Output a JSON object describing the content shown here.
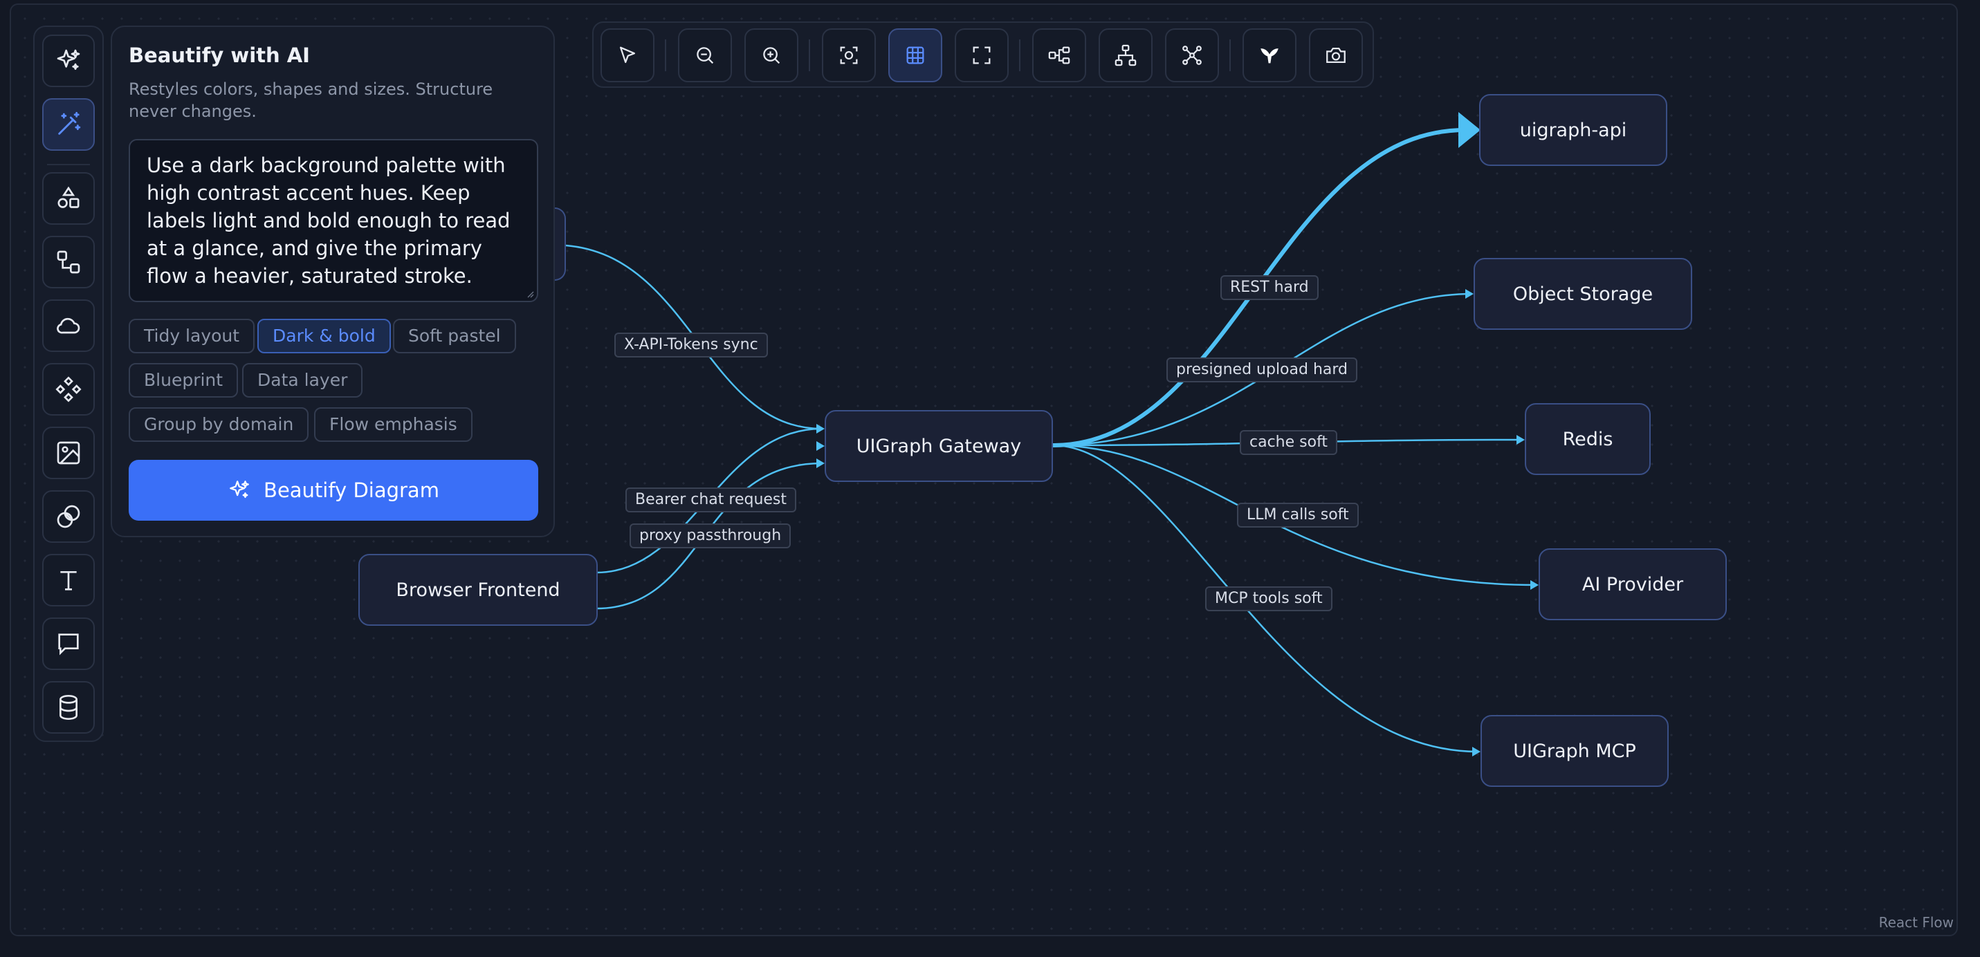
{
  "colors": {
    "background": "#141a27",
    "accent": "#3a6ff7",
    "edge": "#4fc0f4",
    "node_border": "#3a4f86",
    "node_fill": "#1b2135"
  },
  "left_toolbar": {
    "items": [
      {
        "name": "sparkles-icon",
        "active": false
      },
      {
        "name": "magic-wand-icon",
        "active": true
      },
      {
        "name": "shapes-icon",
        "active": false
      },
      {
        "name": "connector-icon",
        "active": false
      },
      {
        "name": "cloud-icon",
        "active": false
      },
      {
        "name": "components-icon",
        "active": false
      },
      {
        "name": "image-icon",
        "active": false
      },
      {
        "name": "layers-icon",
        "active": false
      },
      {
        "name": "text-icon",
        "active": false
      },
      {
        "name": "comment-icon",
        "active": false
      },
      {
        "name": "database-icon",
        "active": false
      }
    ]
  },
  "beautify_panel": {
    "title": "Beautify with AI",
    "subtitle": "Restyles colors, shapes and sizes. Structure never changes.",
    "prompt_value": "Use a dark background palette with high contrast accent hues. Keep labels light and bold enough to read at a glance, and give the primary flow a heavier, saturated stroke.",
    "presets": [
      "Tidy layout",
      "Dark & bold",
      "Soft pastel",
      "Blueprint",
      "Data layer",
      "Group by domain",
      "Flow emphasis"
    ],
    "selected_preset": "Dark & bold",
    "button_label": "Beautify Diagram",
    "button_icon": "sparkles-icon"
  },
  "top_toolbar": {
    "items": [
      "pointer-icon",
      "zoom-out-icon",
      "zoom-in-icon",
      "focus-icon",
      "grid-icon",
      "fit-view-icon",
      "layout-horizontal-icon",
      "layout-tree-icon",
      "layout-force-icon",
      "mermaid-icon",
      "camera-icon"
    ],
    "active": "grid-icon"
  },
  "diagram": {
    "nodes": {
      "gateway": "UIGraph Gateway",
      "browser": "Browser Frontend",
      "api": "uigraph-api",
      "storage": "Object Storage",
      "redis": "Redis",
      "ai": "AI Provider",
      "mcp": "UIGraph MCP"
    },
    "edge_labels": {
      "tokens": "X-API-Tokens sync",
      "bearer": "Bearer chat request",
      "proxy": "proxy passthrough",
      "rest": "REST hard",
      "presigned": "presigned upload hard",
      "cache": "cache soft",
      "llm": "LLM calls soft",
      "mcp_tools": "MCP tools soft"
    }
  },
  "attribution": "React Flow"
}
